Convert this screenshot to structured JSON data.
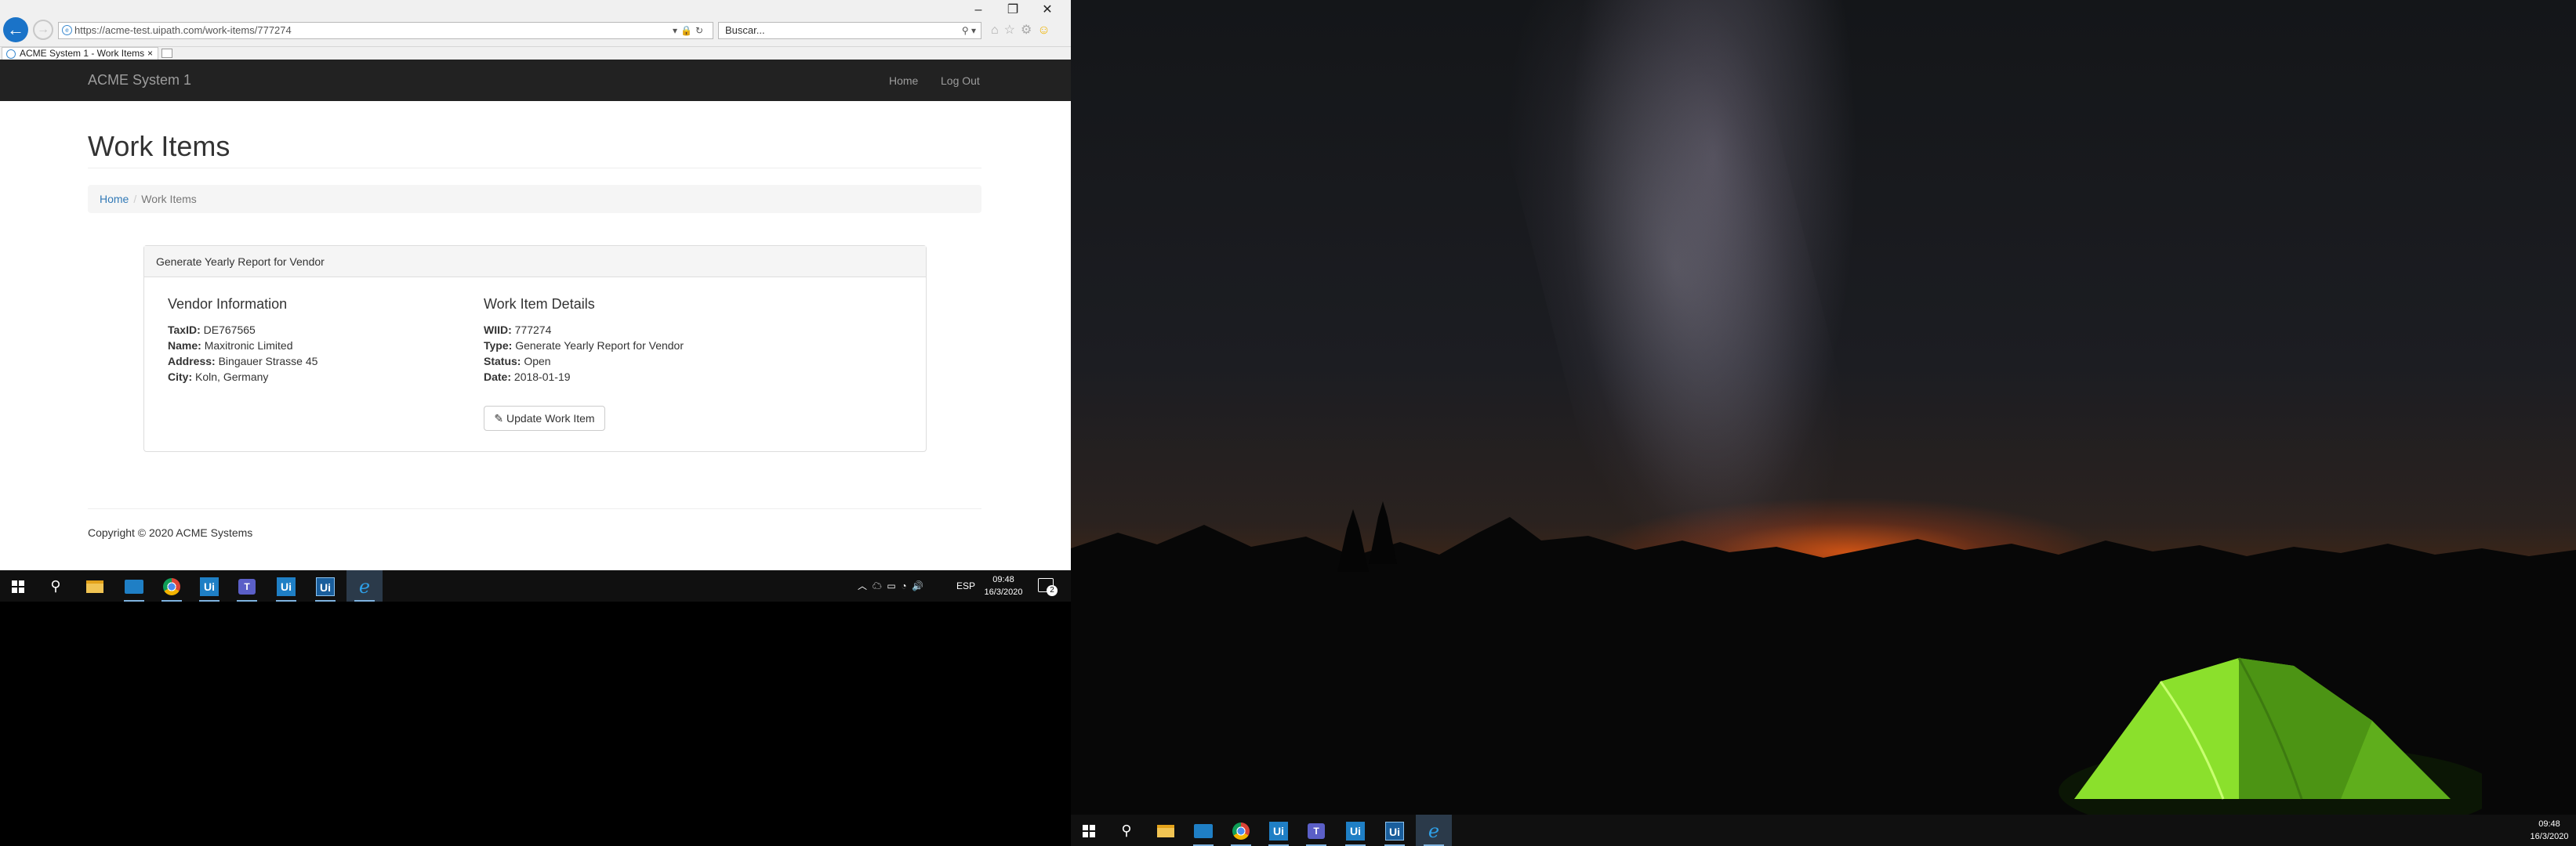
{
  "browser": {
    "url": "https://acme-test.uipath.com/work-items/777274",
    "search_placeholder": "Buscar...",
    "tab_title": "ACME System 1 - Work Items",
    "tab_close": "×"
  },
  "navbar": {
    "brand": "ACME System 1",
    "home_label": "Home",
    "logout_label": "Log Out"
  },
  "page": {
    "title": "Work Items",
    "breadcrumb": {
      "home": "Home",
      "current": "Work Items"
    },
    "panel_heading": "Generate Yearly Report for Vendor",
    "vendor": {
      "heading": "Vendor Information",
      "taxid_label": "TaxID:",
      "taxid": "DE767565",
      "name_label": "Name:",
      "name": "Maxitronic Limited",
      "address_label": "Address:",
      "address": "Bingauer Strasse 45",
      "city_label": "City:",
      "city": "Koln, Germany"
    },
    "details": {
      "heading": "Work Item Details",
      "wiid_label": "WIID:",
      "wiid": "777274",
      "type_label": "Type:",
      "type": "Generate Yearly Report for Vendor",
      "status_label": "Status:",
      "status": "Open",
      "date_label": "Date:",
      "date": "2018-01-19"
    },
    "update_button": "Update Work Item",
    "copyright": "Copyright © 2020 ACME Systems"
  },
  "taskbar_left": {
    "language": "ESP",
    "time": "09:48",
    "date": "16/3/2020",
    "notification_count": "2"
  },
  "taskbar_right": {
    "time": "09:48",
    "date": "16/3/2020"
  },
  "taskbar_icons": [
    "start-icon",
    "search-icon",
    "file-explorer-icon",
    "mail-icon",
    "chrome-icon",
    "uipath-studio-icon",
    "teams-icon",
    "uipath-robot-icon",
    "uipath-assistant-icon",
    "internet-explorer-icon"
  ],
  "colors": {
    "navbar_bg": "#222222",
    "link": "#337ab7",
    "taskbar_bg": "#101010",
    "ie_blue": "#1a73c8"
  }
}
